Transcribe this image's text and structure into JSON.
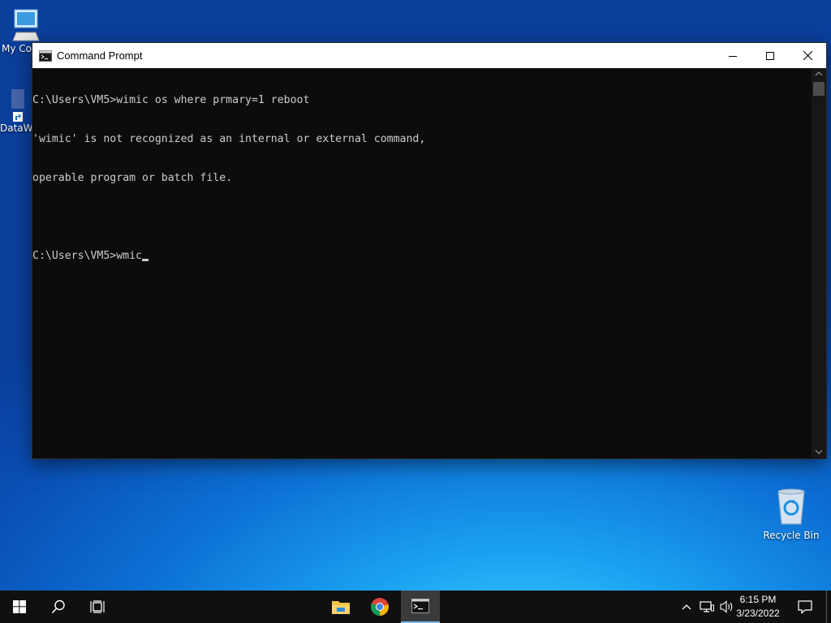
{
  "desktop": {
    "icons": [
      {
        "label": "My Co"
      },
      {
        "label": "DataW"
      },
      {
        "label": "Recycle Bin"
      }
    ]
  },
  "window": {
    "title": "Command Prompt",
    "console_lines": [
      "C:\\Users\\VM5>wimic os where prmary=1 reboot",
      "'wimic' is not recognized as an internal or external command,",
      "operable program or batch file.",
      "",
      "C:\\Users\\VM5>wmic"
    ]
  },
  "taskbar": {
    "time": "6:15 PM",
    "date": "3/23/2022",
    "icons": [
      "start-icon",
      "search-icon",
      "task-view-icon",
      "file-explorer-icon",
      "chrome-icon",
      "command-prompt-icon",
      "chevron-up-icon",
      "network-icon",
      "volume-icon",
      "notification-icon"
    ]
  }
}
